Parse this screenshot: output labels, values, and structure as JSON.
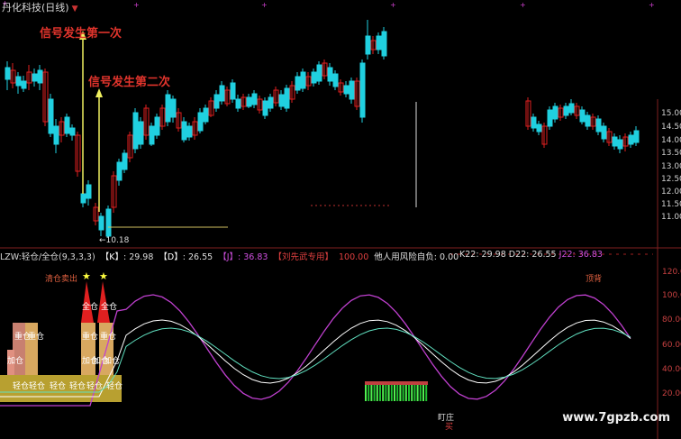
{
  "header": {
    "title": "丹化科技(日线)",
    "arrow": "▼"
  },
  "annotations": {
    "signal_first": "信号发生第一次",
    "signal_second": "信号发生第二次",
    "low_price": "10.18"
  },
  "price_axis": [
    "15.00",
    "14.50",
    "14.00",
    "13.50",
    "13.00",
    "12.50",
    "12.00",
    "11.50",
    "11.00"
  ],
  "indicator": {
    "name": "LZW:轻仓/全仓(9,3,3,3)",
    "k_label": "【K】",
    "k_value": ": 29.98",
    "d_label": "【D】",
    "d_value": ": 26.55",
    "j_label": "【J】",
    "j_value": ": 36.83",
    "author": "【刘先武专用】",
    "val100": "100.00",
    "risk_text": "他人用风险自负: 0.00",
    "k22": "K22: 29.98",
    "d22": "D22: 26.55",
    "j22": "J22: 36.83",
    "axis": [
      "120.00",
      "100.00",
      "80.00",
      "60.00",
      "40.00",
      "20.00"
    ],
    "label_sell": "清仓卖出",
    "label_top": "顶背",
    "label_full_1": "全仓",
    "label_full_2": "全仓",
    "label_heavy_1": "重仓",
    "label_heavy_2": "重仓",
    "label_heavy_3": "重仓",
    "label_heavy_4": "重仓",
    "label_add_1": "加仓",
    "label_add_2": "加仓",
    "label_add_3": "加仓",
    "label_add_4": "加仓",
    "label_light": [
      "轻仓",
      "轻仓",
      "轻仓",
      "轻仓",
      "轻仓",
      "轻仓",
      "轻仓"
    ],
    "label_watch": "盯庄",
    "label_watch_sub": "买"
  },
  "watermark": "www.7gpzb.com",
  "colors": {
    "up": "#e02020",
    "down": "#20d0e0",
    "k": "#ffffff",
    "d": "#60e0c0",
    "j": "#c040d0"
  }
}
